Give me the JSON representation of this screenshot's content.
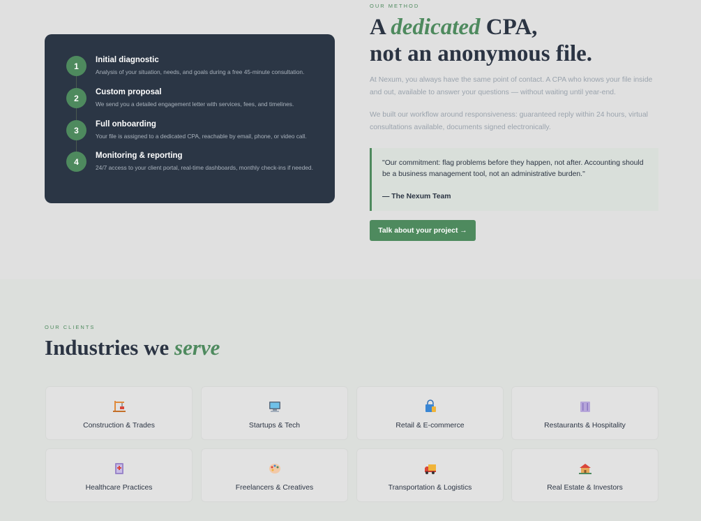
{
  "method": {
    "eyebrow": "OUR METHOD",
    "headline_pre": "A ",
    "headline_accent": "dedicated",
    "headline_post": " CPA,",
    "headline_line2": "not an anonymous file.",
    "para1": "At Nexum, you always have the same point of contact. A CPA who knows your file inside and out, available to answer your questions — without waiting until year-end.",
    "para2": "We built our workflow around responsiveness: guaranteed reply within 24 hours, virtual consultations available, documents signed electronically.",
    "quote": "\"Our commitment: flag problems before they happen, not after. Accounting should be a business management tool, not an administrative burden.\"",
    "quote_author": "— The Nexum Team",
    "cta": "Talk about your project →"
  },
  "steps": [
    {
      "num": "1",
      "title": "Initial diagnostic",
      "desc": "Analysis of your situation, needs, and goals during a free 45-minute consultation."
    },
    {
      "num": "2",
      "title": "Custom proposal",
      "desc": "We send you a detailed engagement letter with services, fees, and timelines."
    },
    {
      "num": "3",
      "title": "Full onboarding",
      "desc": "Your file is assigned to a dedicated CPA, reachable by email, phone, or video call."
    },
    {
      "num": "4",
      "title": "Monitoring & reporting",
      "desc": "24/7 access to your client portal, real-time dashboards, monthly check-ins if needed."
    }
  ],
  "clients": {
    "eyebrow": "OUR CLIENTS",
    "title_pre": "Industries we ",
    "title_accent": "serve",
    "industries": [
      {
        "label": "Construction & Trades",
        "icon": "construction-icon"
      },
      {
        "label": "Startups & Tech",
        "icon": "computer-icon"
      },
      {
        "label": "Retail & E-commerce",
        "icon": "shopping-bag-icon"
      },
      {
        "label": "Restaurants & Hospitality",
        "icon": "utensils-icon"
      },
      {
        "label": "Healthcare Practices",
        "icon": "medical-icon"
      },
      {
        "label": "Freelancers & Creatives",
        "icon": "palette-icon"
      },
      {
        "label": "Transportation & Logistics",
        "icon": "truck-icon"
      },
      {
        "label": "Real Estate & Investors",
        "icon": "house-icon"
      }
    ]
  },
  "colors": {
    "accent": "#4e8a5e",
    "dark_card": "#2b3645",
    "text": "#2b3443",
    "muted": "#9aa3ad"
  }
}
